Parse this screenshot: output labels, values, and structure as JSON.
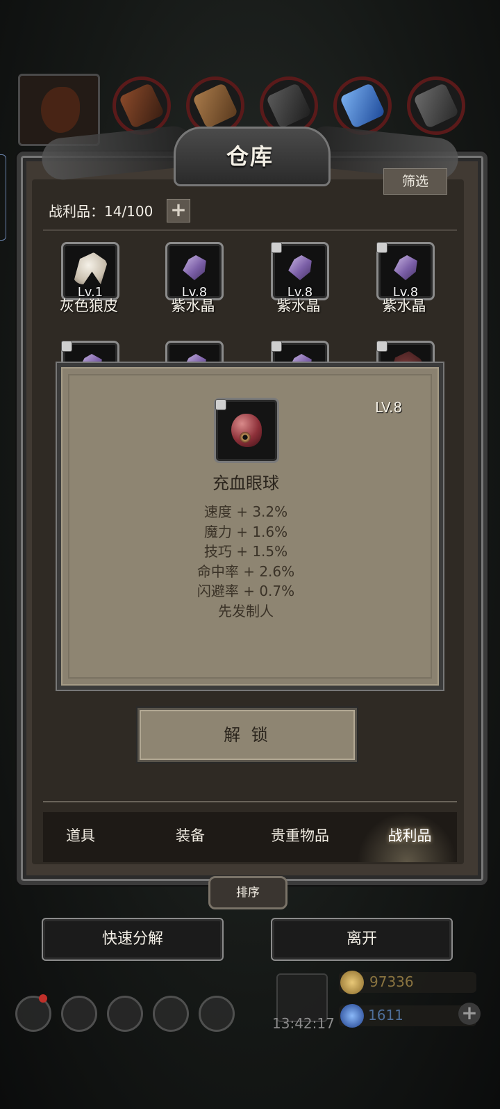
{
  "window": {
    "title": "仓库"
  },
  "toolbar": {
    "filter_label": "筛选"
  },
  "capacity": {
    "label": "战利品：14/100",
    "add_label": "+"
  },
  "materials": [
    {
      "icon": "leather-material-icon"
    },
    {
      "icon": "hide-material-icon"
    },
    {
      "icon": "wood-material-icon"
    },
    {
      "icon": "iron-material-icon"
    },
    {
      "icon": "crystal-material-icon"
    },
    {
      "icon": "ore-material-icon"
    }
  ],
  "items": [
    {
      "level": "Lv.1",
      "name": "灰色狼皮",
      "icon": "wolf-pelt-icon",
      "locked": false
    },
    {
      "level": "Lv.8",
      "name": "紫水晶",
      "icon": "amethyst-icon",
      "locked": false
    },
    {
      "level": "Lv.8",
      "name": "紫水晶",
      "icon": "amethyst-icon",
      "locked": true
    },
    {
      "level": "Lv.8",
      "name": "紫水晶",
      "icon": "amethyst-icon",
      "locked": true
    }
  ],
  "tooltip": {
    "level": "LV.8",
    "name": "充血眼球",
    "icon": "bloodshot-eyeball-icon",
    "stats": [
      "速度 + 3.2%",
      "魔力 + 1.6%",
      "技巧 + 1.5%",
      "命中率 + 2.6%",
      "闪避率 + 0.7%",
      "先发制人"
    ]
  },
  "actions": {
    "unlock_label": "解 锁"
  },
  "tabs": [
    {
      "label": "道具",
      "active": false
    },
    {
      "label": "装备",
      "active": false
    },
    {
      "label": "贵重物品",
      "active": false
    },
    {
      "label": "战利品",
      "active": true
    }
  ],
  "sort_label": "排序",
  "buttons": {
    "quick_decompose": "快速分解",
    "leave": "离开"
  },
  "hud": {
    "clock": "13:42:17",
    "gold": "97336",
    "gems": "1611",
    "plus": "+"
  },
  "colors": {
    "panel": "#413a33",
    "tooltip": "#8e8572",
    "gold": "#c9a24a",
    "gem": "#3f6fd0"
  }
}
